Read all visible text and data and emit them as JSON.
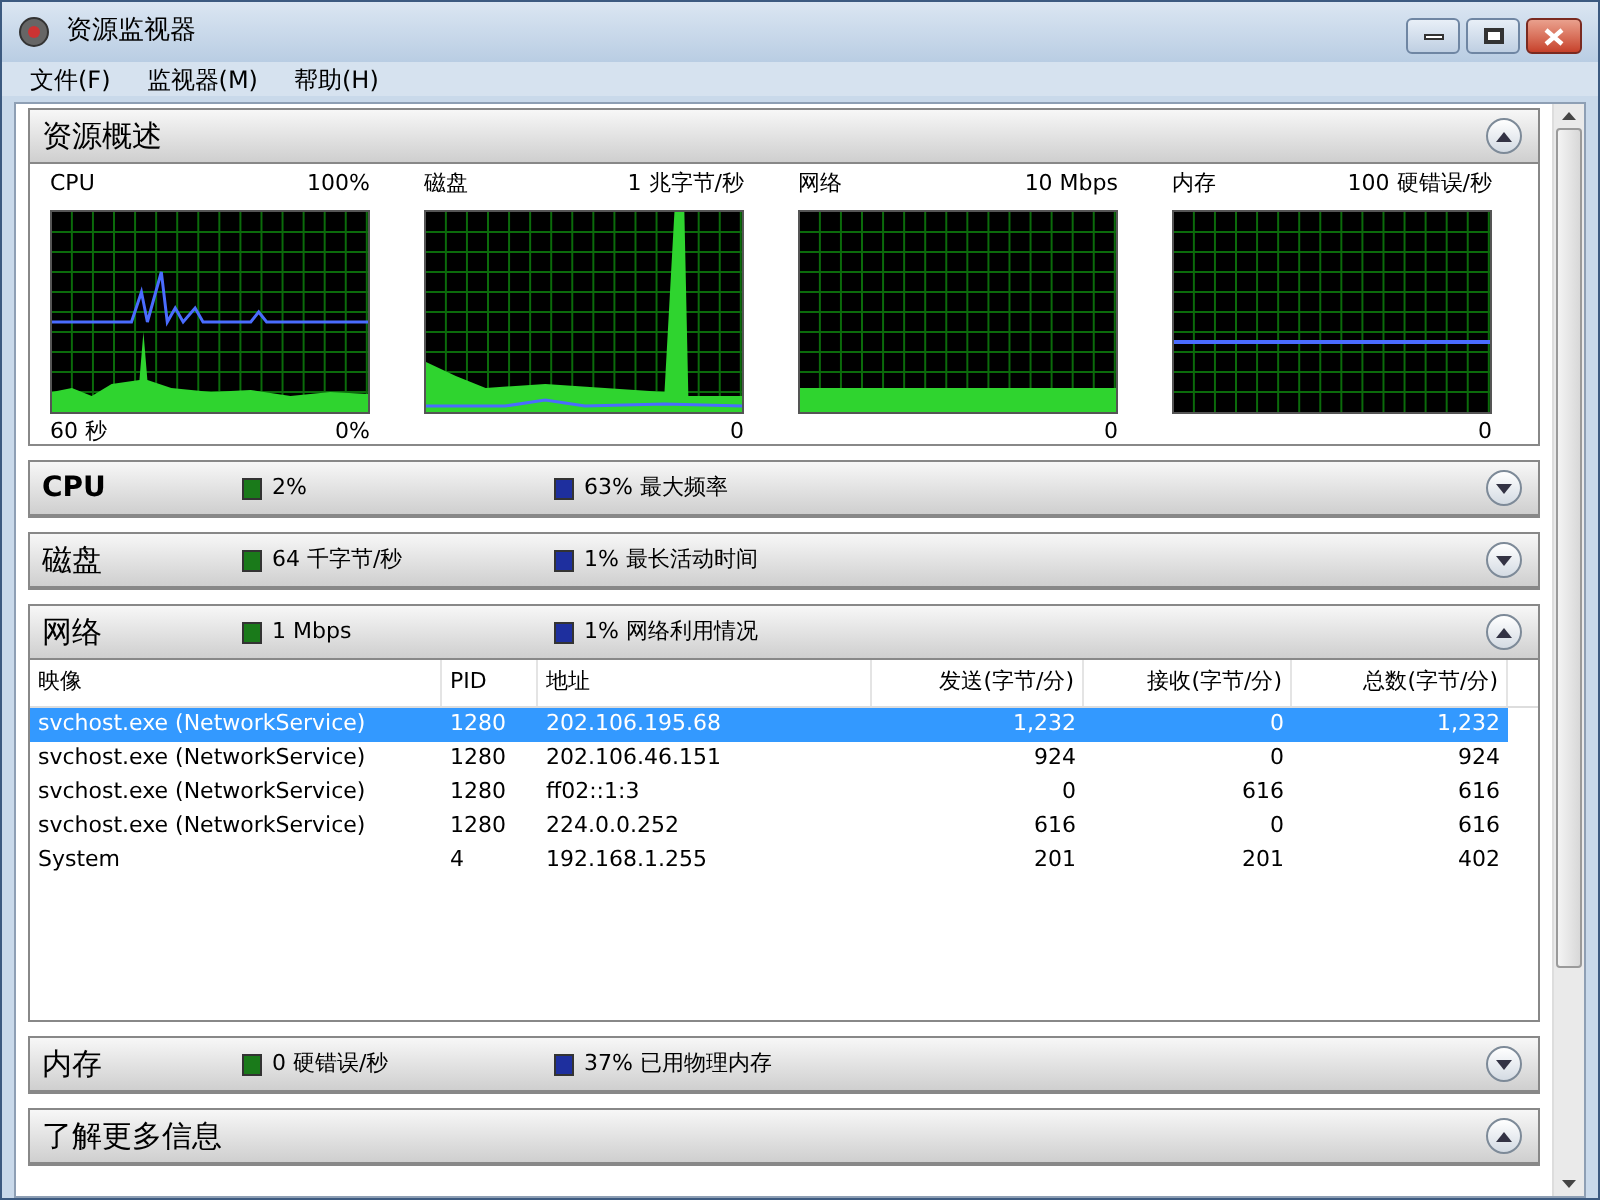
{
  "window": {
    "title": "资源监视器"
  },
  "menu": [
    "文件(F)",
    "监视器(M)",
    "帮助(H)"
  ],
  "overview": {
    "title": "资源概述",
    "expanded": true,
    "graphs": [
      {
        "title": "CPU",
        "max": "100%",
        "time": "60 秒",
        "min": "0%"
      },
      {
        "title": "磁盘",
        "max": "1 兆字节/秒",
        "min": "0"
      },
      {
        "title": "网络",
        "max": "10 Mbps",
        "min": "0"
      },
      {
        "title": "内存",
        "max": "100 硬错误/秒",
        "min": "0"
      }
    ]
  },
  "sections": [
    {
      "title": "CPU",
      "emphasized": true,
      "expanded": false,
      "stats": [
        {
          "text": "2%",
          "color": "#1a7a1a"
        },
        {
          "text": "63% 最大频率",
          "color": "#1e2f9e"
        }
      ]
    },
    {
      "title": "磁盘",
      "emphasized": false,
      "expanded": false,
      "stats": [
        {
          "text": "64 千字节/秒",
          "color": "#1a7a1a"
        },
        {
          "text": "1% 最长活动时间",
          "color": "#1e2f9e"
        }
      ]
    },
    {
      "title": "网络",
      "emphasized": false,
      "expanded": true,
      "stats": [
        {
          "text": "1 Mbps",
          "color": "#1a7a1a"
        },
        {
          "text": "1% 网络利用情况",
          "color": "#1e2f9e"
        }
      ],
      "table": {
        "columns": [
          "映像",
          "PID",
          "地址",
          "发送(字节/分)",
          "接收(字节/分)",
          "总数(字节/分)"
        ],
        "rows": [
          {
            "cells": [
              "svchost.exe (NetworkService)",
              "1280",
              "202.106.195.68",
              "1,232",
              "0",
              "1,232"
            ],
            "selected": true
          },
          {
            "cells": [
              "svchost.exe (NetworkService)",
              "1280",
              "202.106.46.151",
              "924",
              "0",
              "924"
            ],
            "selected": false
          },
          {
            "cells": [
              "svchost.exe (NetworkService)",
              "1280",
              "ff02::1:3",
              "0",
              "616",
              "616"
            ],
            "selected": false
          },
          {
            "cells": [
              "svchost.exe (NetworkService)",
              "1280",
              "224.0.0.252",
              "616",
              "0",
              "616"
            ],
            "selected": false
          },
          {
            "cells": [
              "System",
              "4",
              "192.168.1.255",
              "201",
              "201",
              "402"
            ],
            "selected": false
          }
        ]
      }
    },
    {
      "title": "内存",
      "emphasized": false,
      "expanded": false,
      "stats": [
        {
          "text": "0 硬错误/秒",
          "color": "#1a7a1a"
        },
        {
          "text": "37% 已用物理内存",
          "color": "#1e2f9e"
        }
      ]
    },
    {
      "title": "了解更多信息",
      "emphasized": false,
      "expanded": true
    }
  ]
}
